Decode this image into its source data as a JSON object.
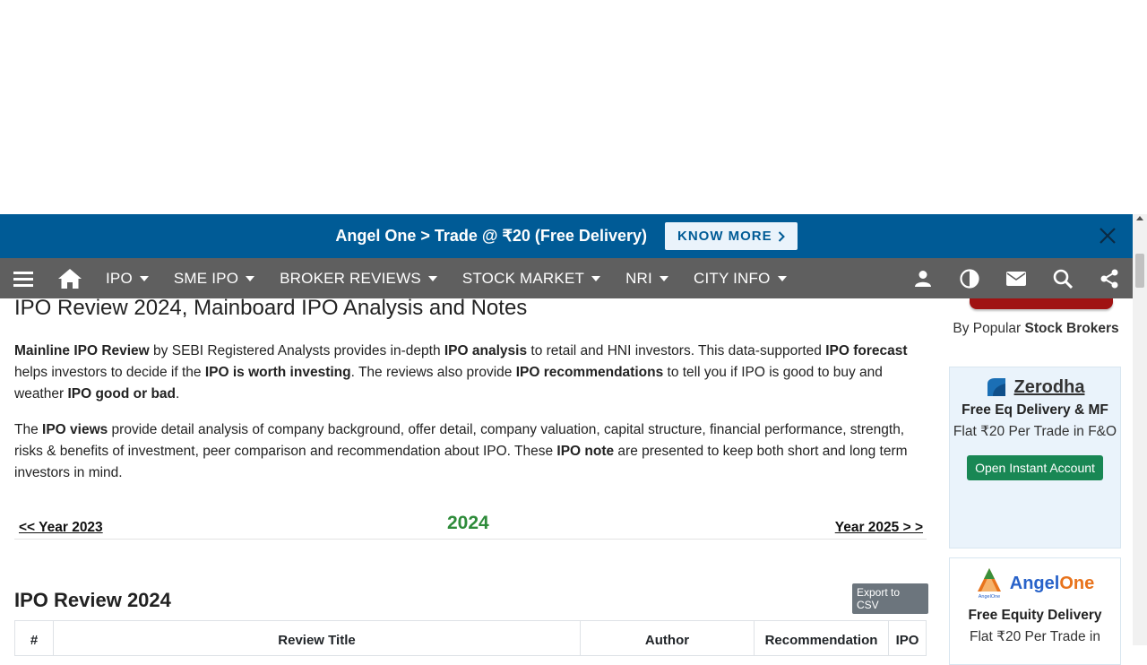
{
  "promo": {
    "text": "Angel One > Trade @ ₹20 (Free Delivery)",
    "button": "KNOW MORE"
  },
  "navbar": {
    "items": [
      {
        "label": "IPO"
      },
      {
        "label": "SME IPO"
      },
      {
        "label": "BROKER REVIEWS"
      },
      {
        "label": "STOCK MARKET"
      },
      {
        "label": "NRI"
      },
      {
        "label": "CITY INFO"
      }
    ],
    "icons": [
      "menu-icon",
      "home-icon",
      "user-icon",
      "contrast-icon",
      "mail-icon",
      "search-icon",
      "share-icon"
    ]
  },
  "main": {
    "title": "IPO Review 2024, Mainboard IPO Analysis and Notes",
    "para1": {
      "t1": "Mainline IPO Review",
      "t2": " by SEBI Registered Analysts provides in-depth ",
      "t3": "IPO analysis",
      "t4": " to retail and HNI investors. This data-supported ",
      "t5": "IPO forecast",
      "t6": " helps investors to decide if the ",
      "t7": "IPO is worth investing",
      "t8": ". The reviews also provide ",
      "t9": "IPO recommendations",
      "t10": " to tell you if IPO is good to buy and weather ",
      "t11": "IPO good or bad",
      "t12": "."
    },
    "para2": {
      "t1": "The ",
      "t2": "IPO views",
      "t3": " provide detail analysis of company background, offer detail, company valuation, capital structure, financial performance, strength, risks & benefits of investment, peer comparison and recommendation about IPO. These ",
      "t4": "IPO note",
      "t5": " are presented to keep both short and long term investors in mind."
    },
    "prev_year": "<< Year 2023",
    "current_year": "2024",
    "next_year": "Year 2025 > >",
    "section_title": "IPO Review 2024",
    "export_label": "Export to CSV",
    "table_headers": [
      "#",
      "Review Title",
      "Author",
      "Recommendation",
      "IPO"
    ]
  },
  "sidebar": {
    "caption_pre": "By Popular ",
    "caption_bold": "Stock Brokers",
    "brokers": [
      {
        "name": "Zerodha",
        "line1": "Free Eq Delivery & MF",
        "line2": "Flat ₹20 Per Trade in F&O",
        "button": "Open Instant Account"
      },
      {
        "name_part1": "Angel",
        "name_part2": "One",
        "logo_text": "AngelOne",
        "line1": "Free Equity Delivery",
        "line2": "Flat ₹20 Per Trade in"
      }
    ]
  },
  "colors": {
    "promo_bg": "#005b96",
    "navbar_bg": "#5f5f5f",
    "year_green": "#2e8b3a",
    "button_green": "#198754",
    "angel_blue": "#2862c9",
    "angel_orange": "#e8731c"
  }
}
